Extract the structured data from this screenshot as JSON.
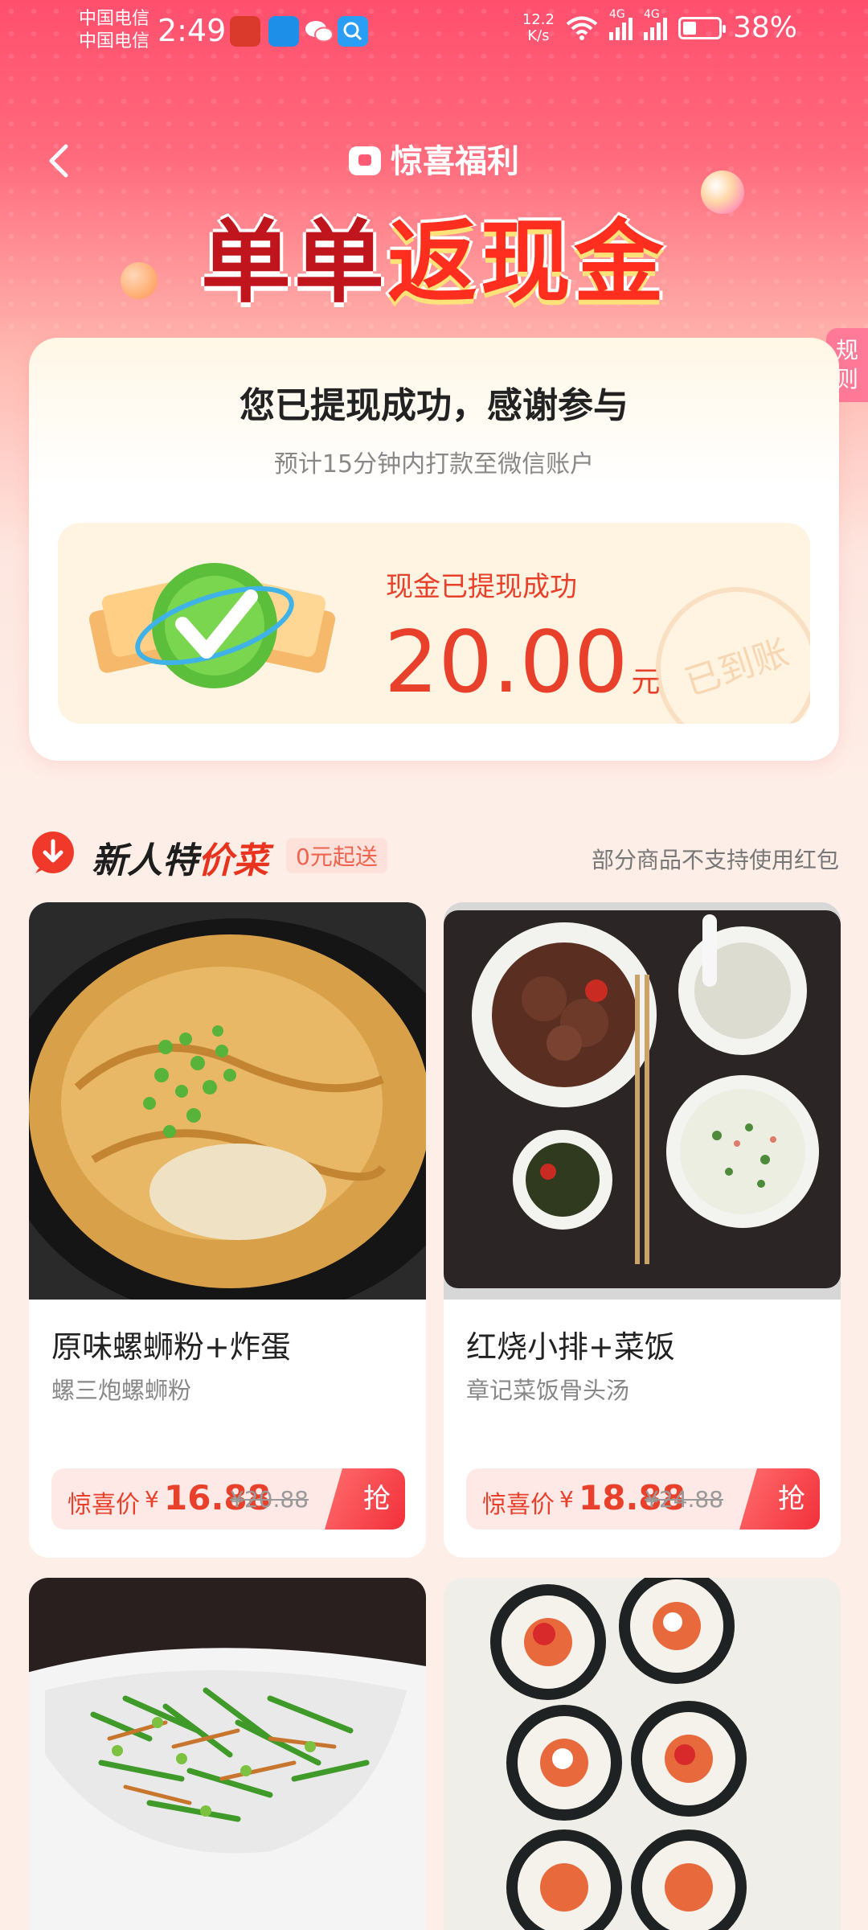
{
  "status_bar": {
    "carrier1": "中国电信",
    "carrier2": "中国电信",
    "time": "2:49",
    "net_speed_value": "12.2",
    "net_speed_unit": "K/s",
    "signal1": "4G",
    "signal2": "4G",
    "battery": "38%"
  },
  "header": {
    "brand": "惊喜福利",
    "headline_part1": "单单",
    "headline_part2": "返现金",
    "rules_label": "规则"
  },
  "success_card": {
    "title": "您已提现成功，感谢参与",
    "subtitle": "预计15分钟内打款至微信账户",
    "cash_label": "现金已提现成功",
    "amount": "20.00",
    "unit": "元",
    "stamp": "已到账"
  },
  "section": {
    "title_part1": "新人特",
    "title_part2": "价菜",
    "badge": "0元起送",
    "note": "部分商品不支持使用红包"
  },
  "products": [
    {
      "name": "原味螺蛳粉+炸蛋",
      "shop": "螺三炮螺蛳粉",
      "price_label": "惊喜价",
      "currency": "¥",
      "price": "16.88",
      "old_price": "¥20.88",
      "action": "抢"
    },
    {
      "name": "红烧小排+菜饭",
      "shop": "章记菜饭骨头汤",
      "price_label": "惊喜价",
      "currency": "¥",
      "price": "18.88",
      "old_price": "¥24.88",
      "action": "抢"
    }
  ],
  "colors": {
    "accent": "#e8402a",
    "hero_top": "#ff4f6e",
    "page_bg": "#fdeee7"
  }
}
